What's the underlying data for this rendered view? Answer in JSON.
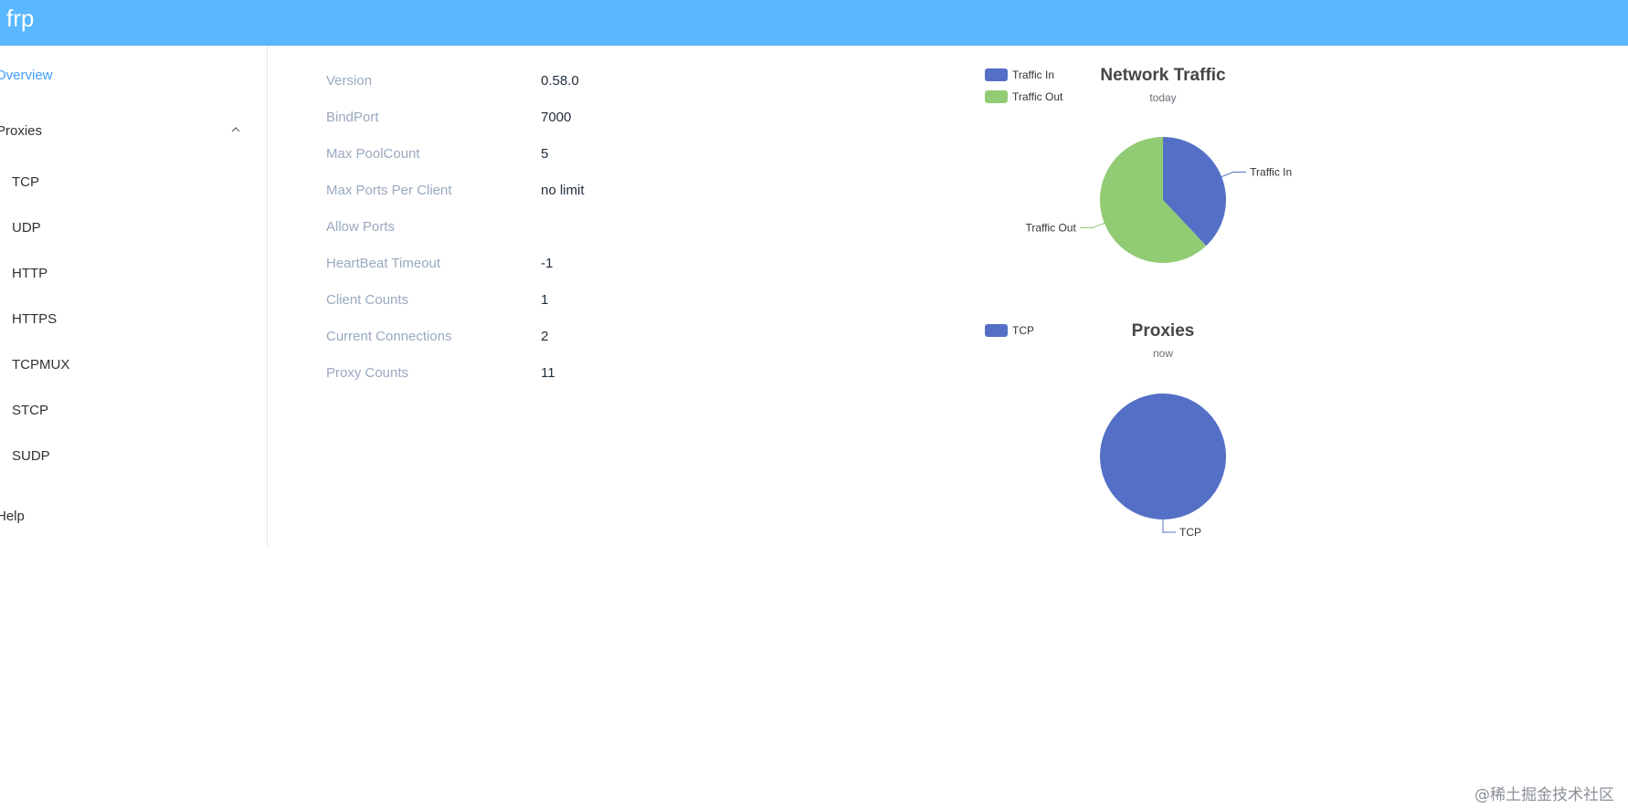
{
  "app": {
    "brand": "frp"
  },
  "sidebar": {
    "overview": "Overview",
    "proxies": "Proxies",
    "proxy_items": [
      "TCP",
      "UDP",
      "HTTP",
      "HTTPS",
      "TCPMUX",
      "STCP",
      "SUDP"
    ],
    "help": "Help"
  },
  "overview": {
    "rows": [
      {
        "label": "Version",
        "value": "0.58.0"
      },
      {
        "label": "BindPort",
        "value": "7000"
      },
      {
        "label": "Max PoolCount",
        "value": "5"
      },
      {
        "label": "Max Ports Per Client",
        "value": "no limit"
      },
      {
        "label": "Allow Ports",
        "value": ""
      },
      {
        "label": "HeartBeat Timeout",
        "value": "-1"
      },
      {
        "label": "Client Counts",
        "value": "1"
      },
      {
        "label": "Current Connections",
        "value": "2"
      },
      {
        "label": "Proxy Counts",
        "value": "11"
      }
    ]
  },
  "chart_data": [
    {
      "type": "pie",
      "title": "Network Traffic",
      "subtitle": "today",
      "legend": [
        "Traffic In",
        "Traffic Out"
      ],
      "legend_placement": "top-left",
      "categories": [
        "Traffic In",
        "Traffic Out"
      ],
      "values": [
        38,
        62
      ],
      "colors": [
        "#5470c6",
        "#91cc75"
      ]
    },
    {
      "type": "pie",
      "title": "Proxies",
      "subtitle": "now",
      "legend": [
        "TCP"
      ],
      "legend_placement": "top-left",
      "categories": [
        "TCP"
      ],
      "values": [
        11
      ],
      "colors": [
        "#5470c6"
      ]
    }
  ],
  "watermark": "@稀土掘金技术社区",
  "colors": {
    "header": "#58b7ff",
    "active": "#409eff",
    "key_text": "#99a9bf"
  }
}
